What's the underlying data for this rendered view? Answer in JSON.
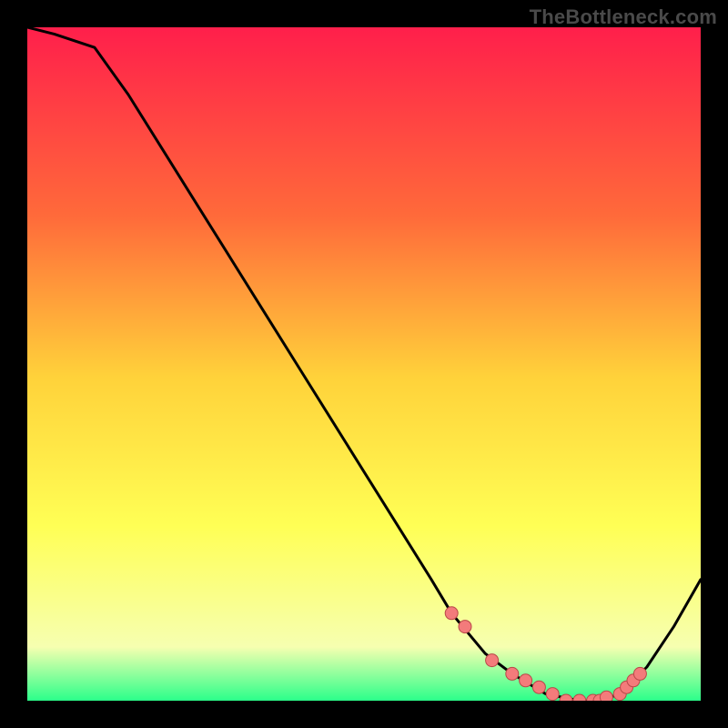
{
  "watermark": "TheBottleneck.com",
  "colors": {
    "frame": "#000000",
    "gradient_top": "#ff1f4b",
    "gradient_mid1": "#ff6a3a",
    "gradient_mid2": "#ffd23a",
    "gradient_mid3": "#ffff55",
    "gradient_bottom_yellow": "#f6ffb0",
    "gradient_bottom_green": "#2bff8a",
    "curve_stroke": "#000000",
    "marker_fill": "#f37b7b",
    "marker_stroke": "#b94848"
  },
  "chart_data": {
    "type": "line",
    "title": "",
    "xlabel": "",
    "ylabel": "",
    "xlim": [
      0,
      100
    ],
    "ylim": [
      0,
      100
    ],
    "series": [
      {
        "name": "bottleneck-curve",
        "x": [
          0,
          4,
          10,
          15,
          20,
          25,
          30,
          35,
          40,
          45,
          50,
          55,
          60,
          63,
          68,
          72,
          77,
          82,
          85,
          88,
          92,
          96,
          100
        ],
        "y": [
          100,
          99,
          97,
          90,
          82,
          74,
          66,
          58,
          50,
          42,
          34,
          26,
          18,
          13,
          7,
          4,
          1,
          0,
          0,
          1,
          5,
          11,
          18
        ]
      }
    ],
    "markers": {
      "name": "highlighted-points",
      "x": [
        63,
        65,
        69,
        72,
        74,
        76,
        78,
        80,
        82,
        84,
        85,
        86,
        88,
        89,
        90,
        91
      ],
      "y": [
        13,
        11,
        6,
        4,
        3,
        2,
        1,
        0,
        0,
        0,
        0,
        0.5,
        1,
        2,
        3,
        4
      ]
    }
  }
}
